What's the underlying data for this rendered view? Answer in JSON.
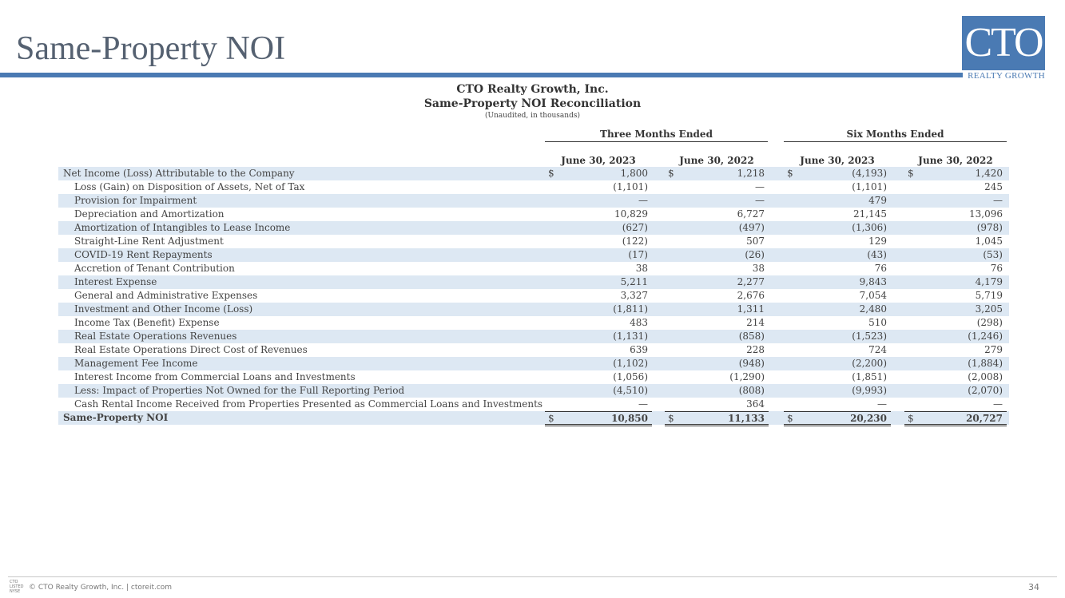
{
  "slide": {
    "title": "Same-Property NOI"
  },
  "logo": {
    "main": "CTO",
    "sub": "REALTY GROWTH"
  },
  "header": {
    "company": "CTO Realty Growth, Inc.",
    "report": "Same-Property NOI Reconciliation",
    "note": "(Unaudited, in thousands)"
  },
  "groups": [
    "Three Months Ended",
    "Six Months Ended"
  ],
  "columns": [
    "June 30, 2023",
    "June 30, 2022",
    "June 30, 2023",
    "June 30, 2022"
  ],
  "rows": [
    {
      "label": "Net Income (Loss) Attributable to the Company",
      "values": [
        "1,800",
        "1,218",
        "(4,193)",
        "1,420"
      ],
      "dollar": [
        "$",
        "$",
        "$",
        "$"
      ]
    },
    {
      "label": "Loss (Gain) on Disposition of Assets, Net of Tax",
      "values": [
        "(1,101)",
        "—",
        "(1,101)",
        "245"
      ]
    },
    {
      "label": "Provision for Impairment",
      "values": [
        "—",
        "—",
        "479",
        "—"
      ]
    },
    {
      "label": "Depreciation and Amortization",
      "values": [
        "10,829",
        "6,727",
        "21,145",
        "13,096"
      ]
    },
    {
      "label": "Amortization of Intangibles to Lease Income",
      "values": [
        "(627)",
        "(497)",
        "(1,306)",
        "(978)"
      ]
    },
    {
      "label": "Straight-Line Rent Adjustment",
      "values": [
        "(122)",
        "507",
        "129",
        "1,045"
      ]
    },
    {
      "label": "COVID-19 Rent Repayments",
      "values": [
        "(17)",
        "(26)",
        "(43)",
        "(53)"
      ]
    },
    {
      "label": "Accretion of Tenant Contribution",
      "values": [
        "38",
        "38",
        "76",
        "76"
      ]
    },
    {
      "label": "Interest Expense",
      "values": [
        "5,211",
        "2,277",
        "9,843",
        "4,179"
      ]
    },
    {
      "label": "General and Administrative Expenses",
      "values": [
        "3,327",
        "2,676",
        "7,054",
        "5,719"
      ]
    },
    {
      "label": "Investment and Other Income (Loss)",
      "values": [
        "(1,811)",
        "1,311",
        "2,480",
        "3,205"
      ]
    },
    {
      "label": "Income Tax (Benefit) Expense",
      "values": [
        "483",
        "214",
        "510",
        "(298)"
      ]
    },
    {
      "label": "Real Estate Operations Revenues",
      "values": [
        "(1,131)",
        "(858)",
        "(1,523)",
        "(1,246)"
      ]
    },
    {
      "label": "Real Estate Operations Direct Cost of Revenues",
      "values": [
        "639",
        "228",
        "724",
        "279"
      ]
    },
    {
      "label": "Management Fee Income",
      "values": [
        "(1,102)",
        "(948)",
        "(2,200)",
        "(1,884)"
      ]
    },
    {
      "label": "Interest Income from Commercial Loans and Investments",
      "values": [
        "(1,056)",
        "(1,290)",
        "(1,851)",
        "(2,008)"
      ]
    },
    {
      "label": "Less: Impact of Properties Not Owned for the Full Reporting Period",
      "values": [
        "(4,510)",
        "(808)",
        "(9,993)",
        "(2,070)"
      ]
    },
    {
      "label": "Cash Rental Income Received from Properties Presented as Commercial Loans and Investments",
      "values": [
        "—",
        "364",
        "—",
        "—"
      ]
    },
    {
      "label": "Same-Property NOI",
      "values": [
        "10,850",
        "11,133",
        "20,230",
        "20,727"
      ],
      "dollar": [
        "$",
        "$",
        "$",
        "$"
      ]
    }
  ],
  "footer": {
    "logo_lines": [
      "CTO",
      "LISTED",
      "NYSE"
    ],
    "text": "© CTO Realty Growth, Inc. | ctoreit.com",
    "page": "34"
  }
}
